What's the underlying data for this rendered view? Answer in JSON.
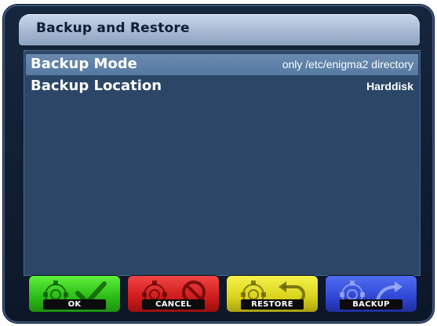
{
  "title": "Backup and Restore",
  "settings": [
    {
      "label": "Backup Mode",
      "value": "only /etc/enigma2 directory",
      "selected": true
    },
    {
      "label": "Backup Location",
      "value": "Harddisk",
      "selected": false
    }
  ],
  "buttons": {
    "ok": {
      "label": "OK",
      "color": "#2bbb16",
      "icon": "checkmark-icon"
    },
    "cancel": {
      "label": "CANCEL",
      "color": "#cf1b1b",
      "icon": "prohibited-icon"
    },
    "restore": {
      "label": "RESTORE",
      "color": "#d9d21b",
      "icon": "undo-arrow-icon"
    },
    "backup": {
      "label": "BACKUP",
      "color": "#2f47d4",
      "icon": "forward-arrow-icon"
    }
  }
}
